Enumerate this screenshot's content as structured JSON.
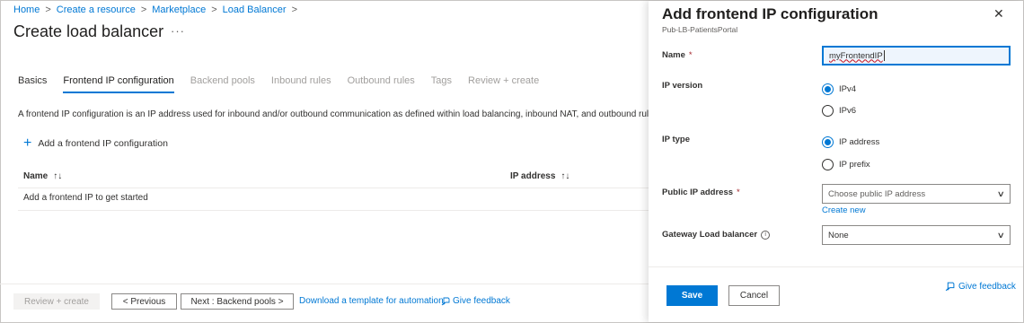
{
  "breadcrumb": {
    "items": [
      "Home",
      "Create a resource",
      "Marketplace",
      "Load Balancer"
    ],
    "separator": ">"
  },
  "page": {
    "title": "Create load balancer",
    "more_glyph": "···"
  },
  "tabs": [
    {
      "label": "Basics",
      "state": "done"
    },
    {
      "label": "Frontend IP configuration",
      "state": "active"
    },
    {
      "label": "Backend pools",
      "state": "disabled"
    },
    {
      "label": "Inbound rules",
      "state": "disabled"
    },
    {
      "label": "Outbound rules",
      "state": "disabled"
    },
    {
      "label": "Tags",
      "state": "disabled"
    },
    {
      "label": "Review + create",
      "state": "disabled"
    }
  ],
  "description": "A frontend IP configuration is an IP address used for inbound and/or outbound communication as defined within load balancing, inbound NAT, and outbound rules.",
  "add_config_label": "Add a frontend IP configuration",
  "grid": {
    "columns": [
      "Name",
      "IP address"
    ],
    "sort_glyph": "↑↓",
    "empty_row": "Add a frontend IP to get started"
  },
  "footer": {
    "review_create": "Review + create",
    "previous": "< Previous",
    "next": "Next : Backend pools >",
    "download_template": "Download a template for automation",
    "give_feedback": "Give feedback"
  },
  "panel": {
    "title": "Add frontend IP configuration",
    "subtitle": "Pub-LB-PatientsPortal",
    "close_glyph": "✕",
    "fields": {
      "name": {
        "label": "Name",
        "required_mark": "*",
        "value": "myFrontendIP"
      },
      "ip_version": {
        "label": "IP version",
        "options": [
          {
            "label": "IPv4",
            "selected": true
          },
          {
            "label": "IPv6",
            "selected": false
          }
        ]
      },
      "ip_type": {
        "label": "IP type",
        "options": [
          {
            "label": "IP address",
            "selected": true
          },
          {
            "label": "IP prefix",
            "selected": false
          }
        ]
      },
      "public_ip": {
        "label": "Public IP address",
        "required_mark": "*",
        "placeholder": "Choose public IP address",
        "create_new": "Create new"
      },
      "gateway_lb": {
        "label": "Gateway Load balancer",
        "value": "None",
        "info_icon": "info-icon"
      }
    },
    "save": "Save",
    "cancel": "Cancel",
    "give_feedback": "Give feedback"
  },
  "colors": {
    "accent": "#0078d4",
    "required": "#a4262c",
    "text": "#323130",
    "disabled_text": "#a19f9d"
  }
}
